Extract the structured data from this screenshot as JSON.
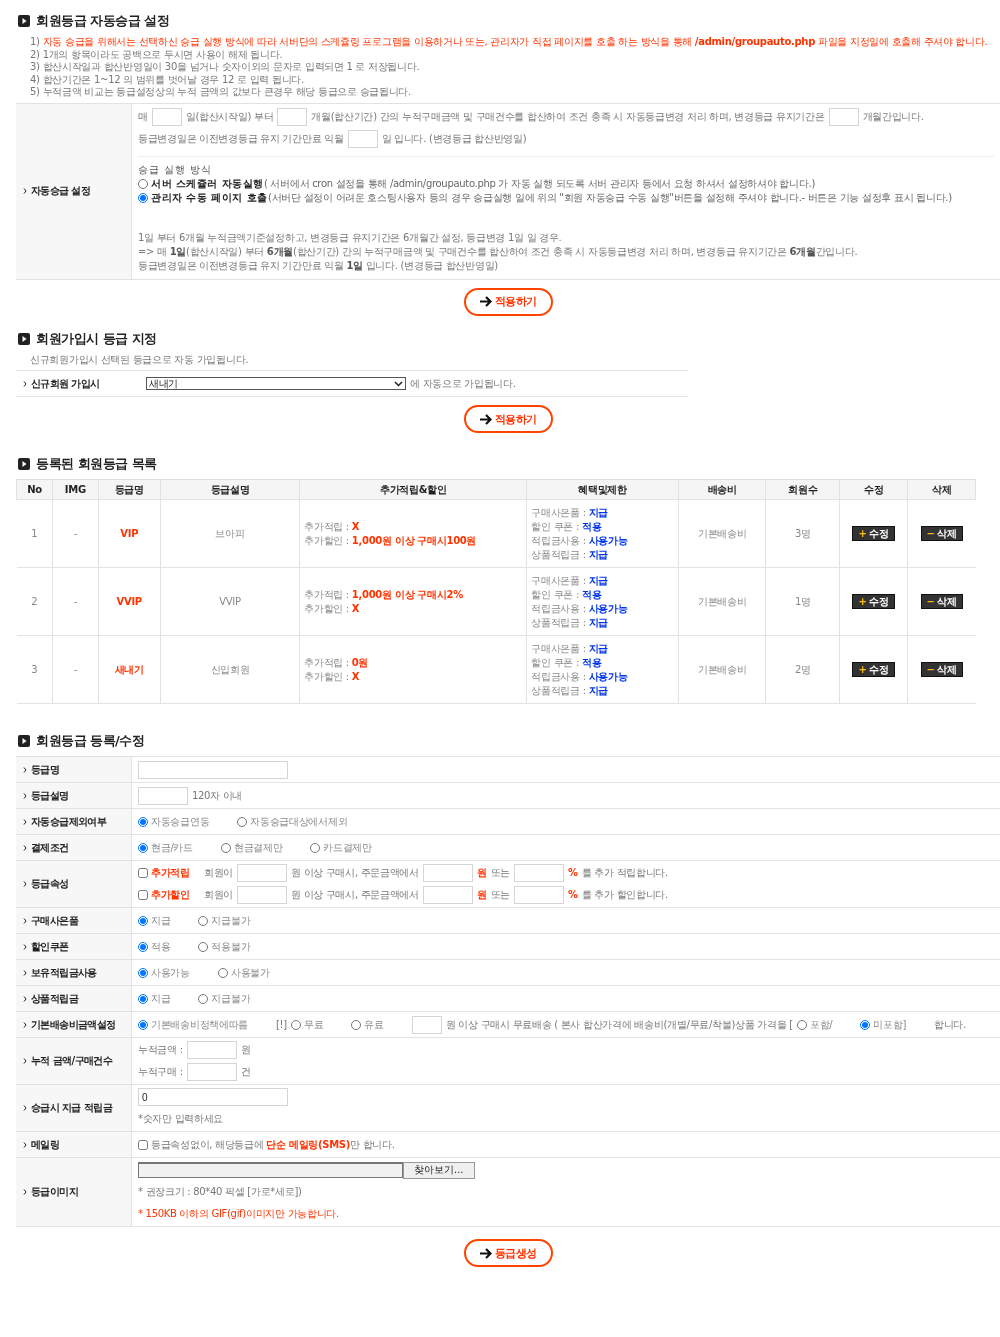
{
  "auto_upgrade": {
    "title": "회원등급 자동승급 설정",
    "notes": [
      {
        "number": "1)",
        "text": "자동 승급을 위해서는 선택하신 승급 실행 방식에 따라 서버단의 스케쥴링 프로그램을 이용하거나 또는, 관리자가 직접 페이지를 호출 하는 방식을 통해 **/admin/groupauto.php** 파일을 지정일에 호출해 주셔야 합니다.",
        "kind": "warning"
      },
      {
        "number": "2)",
        "text": "1개의 항목이라도 공백으로 두시면 사용이 해제 됩니다.",
        "kind": "plain"
      },
      {
        "number": "3)",
        "text": "합산시작일과 합산반영일이 30을 넘거나 숫자이외의 문자로 입력되면 1 로 저장됩니다.",
        "kind": "plain"
      },
      {
        "number": "4)",
        "text": "합산기간은 1~12 의 범위를 벗어날 경우 12 로 입력 됩니다.",
        "kind": "plain"
      },
      {
        "number": "5)",
        "text": "누적금액 비교는 등급설정상의 누적 금액의 값보다 큰경우 해당 등급으로 승급됩니다.",
        "kind": "plain"
      }
    ],
    "setting_label": "자동승급 설정",
    "period_lines": [
      [
        {
          "kind": "text",
          "text": "매"
        },
        {
          "kind": "short_input"
        },
        {
          "kind": "text",
          "text": "일(합산시작일) 부터"
        },
        {
          "kind": "short_input"
        },
        {
          "kind": "text",
          "text": "개월(합산기간) 간의 누적구매금액 및 구매건수를 합산하여 조건 충족 시 자동등급변경 처리 하며, 변경등급 유지기간은"
        },
        {
          "kind": "short_input"
        },
        {
          "kind": "text",
          "text": "개월간입니다."
        }
      ],
      [
        {
          "kind": "text",
          "text": "등급변경일은 이전변경등급 유지 기간만료 익월"
        },
        {
          "kind": "short_input"
        },
        {
          "kind": "text",
          "text": "일 입니다. (변경등급 합산반영일)"
        }
      ]
    ],
    "method": {
      "heading": "승급 실행 방식",
      "options": [
        {
          "label": "서버 스케쥴러 자동실행",
          "note": "( 서버에서 cron 설정을 통해 /admin/groupauto.php 가 자동 실행 되도록 서버 관리자 등에서 요청 하셔서 설정하셔야 합니다.)",
          "selected": false
        },
        {
          "label": "관리자 수동 페이지 호출",
          "note": "(서버단 설정이 어려운 호스팅사용자 등의 경우 승급실행 일에 위의 \"회원 자동승급 수동 실행\"버튼을 설정해 주셔야 합니다.- 버튼은 기능 설정후 표시 됩니다.)",
          "selected": true
        }
      ]
    },
    "example_lines": [
      "1일 부터 6개월 누적금액기준설정하고, 변경등급 유지기간은 6개월간 설정, 등급변경 1일 일 경우.",
      "=> 매 **1일**(합산시작일) 부터 **6개월**(합산기간) 간의 누적구매금액 및 구매건수를 합산하여 조건 충족 시 자동등급변경 처리 하며, 변경등급 유지기간은 **6개월**간입니다.",
      "등급변경일은 이전변경등급 유지 기간만료 익월 **1일** 입니다. (변경등급 합산반영일)"
    ],
    "apply_button": "적용하기"
  },
  "join_grade": {
    "title": "회원가입시 등급 지정",
    "description": "신규회원가입시 선택된 등급으로 자동 가입됩니다.",
    "label": "신규회원 가입시",
    "selected_grade": "새내기",
    "suffix": "에 자동으로 가입됩니다.",
    "apply_button": "적용하기"
  },
  "grade_list": {
    "title": "등록된 회원등급 목록",
    "columns": [
      "No",
      "IMG",
      "등급명",
      "등급설명",
      "추가적립&할인",
      "혜택및제한",
      "배송비",
      "회원수",
      "수정",
      "삭제"
    ],
    "rows": [
      {
        "no": "1",
        "img": "-",
        "name": "VIP",
        "description": "브아피",
        "extras": [
          {
            "label": "추가적립 :",
            "value": "X"
          },
          {
            "label": "추가할인 :",
            "value": "1,000원 이상 구매시100원"
          }
        ],
        "benefits": [
          {
            "label": "구매사은품 :",
            "value": "지급"
          },
          {
            "label": "할인 쿠폰 :",
            "value": "적용"
          },
          {
            "label": "적립금사용 :",
            "value": "사용가능"
          },
          {
            "label": "상품적립금 :",
            "value": "지급"
          }
        ],
        "shipping": "기본배송비",
        "members": "3명",
        "edit": {
          "icon": "+",
          "label": "수정"
        },
        "delete": {
          "icon": "−",
          "label": "삭제"
        }
      },
      {
        "no": "2",
        "img": "-",
        "name": "VVIP",
        "description": "VVIP",
        "extras": [
          {
            "label": "추가적립 :",
            "value": "1,000원 이상 구매시2%"
          },
          {
            "label": "추가할인 :",
            "value": "X"
          }
        ],
        "benefits": [
          {
            "label": "구매사은품 :",
            "value": "지급"
          },
          {
            "label": "할인 쿠폰 :",
            "value": "적용"
          },
          {
            "label": "적립금사용 :",
            "value": "사용가능"
          },
          {
            "label": "상품적립금 :",
            "value": "지급"
          }
        ],
        "shipping": "기본배송비",
        "members": "1명",
        "edit": {
          "icon": "+",
          "label": "수정"
        },
        "delete": {
          "icon": "−",
          "label": "삭제"
        }
      },
      {
        "no": "3",
        "img": "-",
        "name": "새내기",
        "description": "신입회원",
        "extras": [
          {
            "label": "추가적립 :",
            "value": "0원"
          },
          {
            "label": "추가할인 :",
            "value": "X"
          }
        ],
        "benefits": [
          {
            "label": "구매사은품 :",
            "value": "지급"
          },
          {
            "label": "할인 쿠폰 :",
            "value": "적용"
          },
          {
            "label": "적립금사용 :",
            "value": "사용가능"
          },
          {
            "label": "상품적립금 :",
            "value": "지급"
          }
        ],
        "shipping": "기본배송비",
        "members": "2명",
        "edit": {
          "icon": "+",
          "label": "수정"
        },
        "delete": {
          "icon": "−",
          "label": "삭제"
        }
      }
    ]
  },
  "grade_form": {
    "title": "회원등급 등록/수정",
    "rows": [
      {
        "label": "등급명",
        "lines": [
          [
            {
              "kind": "wide_input"
            }
          ]
        ]
      },
      {
        "label": "등급설명",
        "lines": [
          [
            {
              "kind": "input"
            },
            {
              "kind": "text",
              "text": "120자 이내"
            }
          ]
        ]
      },
      {
        "label": "자동승급제외여부",
        "lines": [
          [
            {
              "kind": "radio",
              "label": "자동승급연동",
              "selected": true
            },
            {
              "kind": "radio",
              "label": "자동승급대상에서제외",
              "selected": false
            }
          ]
        ]
      },
      {
        "label": "결제조건",
        "lines": [
          [
            {
              "kind": "radio",
              "label": "현금/카드",
              "selected": true
            },
            {
              "kind": "radio",
              "label": "현금결제만",
              "selected": false
            },
            {
              "kind": "radio",
              "label": "카드결제만",
              "selected": false
            }
          ]
        ]
      },
      {
        "label": "등급속성",
        "lines": [
          [
            {
              "kind": "checkbox",
              "label": "추가적립",
              "checked": false
            },
            {
              "kind": "text",
              "text": "회원이"
            },
            {
              "kind": "input"
            },
            {
              "kind": "text",
              "text": "원 이상 구매시, 주문금액에서"
            },
            {
              "kind": "input"
            },
            {
              "kind": "alert_text",
              "text": "원"
            },
            {
              "kind": "text",
              "text": "또는"
            },
            {
              "kind": "input"
            },
            {
              "kind": "alert_text",
              "text": "%"
            },
            {
              "kind": "text",
              "text": "를 추가 적립합니다."
            }
          ],
          [
            {
              "kind": "checkbox",
              "label": "추가할인",
              "checked": false
            },
            {
              "kind": "text",
              "text": "회원이"
            },
            {
              "kind": "input"
            },
            {
              "kind": "text",
              "text": "원 이상 구매시, 주문금액에서"
            },
            {
              "kind": "input"
            },
            {
              "kind": "alert_text",
              "text": "원"
            },
            {
              "kind": "text",
              "text": "또는"
            },
            {
              "kind": "input"
            },
            {
              "kind": "alert_text",
              "text": "%"
            },
            {
              "kind": "text",
              "text": "를 추가 할인합니다."
            }
          ]
        ]
      },
      {
        "label": "구매사은품",
        "lines": [
          [
            {
              "kind": "radio",
              "label": "지급",
              "selected": true
            },
            {
              "kind": "radio",
              "label": "지급불가",
              "selected": false
            }
          ]
        ]
      },
      {
        "label": "할인쿠폰",
        "lines": [
          [
            {
              "kind": "radio",
              "label": "적용",
              "selected": true
            },
            {
              "kind": "radio",
              "label": "적용불가",
              "selected": false
            }
          ]
        ]
      },
      {
        "label": "보유적립금사용",
        "lines": [
          [
            {
              "kind": "radio",
              "label": "사용가능",
              "selected": true
            },
            {
              "kind": "radio",
              "label": "사용불가",
              "selected": false
            }
          ]
        ]
      },
      {
        "label": "상품적립금",
        "lines": [
          [
            {
              "kind": "radio",
              "label": "지급",
              "selected": true
            },
            {
              "kind": "radio",
              "label": "지급불가",
              "selected": false
            }
          ]
        ]
      },
      {
        "label": "기본배송비금액설정",
        "lines": [
          [
            {
              "kind": "radio",
              "label": "기본배송비정책에따름",
              "selected": true
            },
            {
              "kind": "text",
              "text": "[!]"
            },
            {
              "kind": "radio",
              "label": "무료",
              "selected": false
            },
            {
              "kind": "radio",
              "label": "유료",
              "selected": false
            },
            {
              "kind": "short_input"
            },
            {
              "kind": "text",
              "text": "원 이상 구매시 무료배송 ( 본사 합산가격에 배송비(개별/무료/착불)상품 가격을 ["
            },
            {
              "kind": "radio",
              "label": "포함/",
              "selected": false
            },
            {
              "kind": "radio",
              "label": "미포함]",
              "selected": true
            },
            {
              "kind": "text",
              "text": "합니다."
            }
          ]
        ]
      },
      {
        "label": "누적 금액/구매건수",
        "lines": [
          [
            {
              "kind": "text",
              "text": "누적금액 :"
            },
            {
              "kind": "input"
            },
            {
              "kind": "text",
              "text": "원"
            }
          ],
          [
            {
              "kind": "text",
              "text": "누적구매 :"
            },
            {
              "kind": "input"
            },
            {
              "kind": "text",
              "text": "건"
            }
          ]
        ]
      },
      {
        "label": "승급시 지급 적립금",
        "lines": [
          [
            {
              "kind": "wide_input",
              "value": "0"
            }
          ],
          [
            {
              "kind": "text",
              "text": "*숫자만 입력하세요"
            }
          ]
        ]
      },
      {
        "label": "메일링",
        "lines": [
          [
            {
              "kind": "checkbox",
              "checked": false
            },
            {
              "kind": "text",
              "text": "등급속성없이, 해당등급에 **단순 메일링(SMS)**만 합니다."
            }
          ]
        ]
      },
      {
        "label": "등급이미지",
        "lines": [
          [
            {
              "kind": "file",
              "button": "찾아보기..."
            }
          ],
          [
            {
              "kind": "text",
              "text": "* 권장크기 : 80*40 픽셀 [가로*세로])"
            }
          ],
          [
            {
              "kind": "alert_text",
              "text": "* 150KB 이하의 GIF(gif)이미지만 가능합니다."
            }
          ]
        ]
      }
    ],
    "submit_button": "등급생성"
  }
}
